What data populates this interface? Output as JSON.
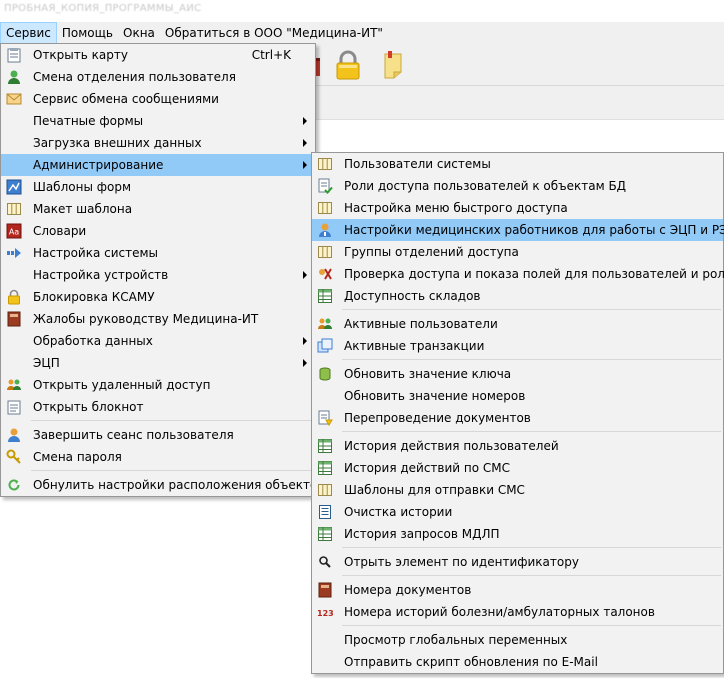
{
  "window": {
    "title": "ПРОБНАЯ_КОПИЯ_ПРОГРАММЫ_АИС"
  },
  "menubar": {
    "items": [
      {
        "label": "Сервис"
      },
      {
        "label": "Помощь"
      },
      {
        "label": "Окна"
      },
      {
        "label": "Обратиться в ООО \"Медицина-ИТ\""
      }
    ]
  },
  "toolbar": {
    "icons": [
      "lock-icon",
      "note-icon"
    ]
  },
  "service_menu": {
    "items": [
      {
        "label": "Открыть карту",
        "shortcut": "Ctrl+K",
        "icon": "card-icon"
      },
      {
        "label": "Смена отделения пользователя",
        "icon": "user-icon"
      },
      {
        "label": "Сервис обмена сообщениями",
        "icon": "envelope-icon"
      },
      {
        "label": "Печатные формы",
        "submenu": true
      },
      {
        "label": "Загрузка внешних данных",
        "submenu": true
      },
      {
        "label": "Администрирование",
        "submenu": true,
        "highlighted": true
      },
      {
        "label": "Шаблоны форм",
        "icon": "template-icon"
      },
      {
        "label": "Макет шаблона",
        "icon": "grid-icon"
      },
      {
        "label": "Словари",
        "icon": "dictionary-icon"
      },
      {
        "label": "Настройка системы",
        "icon": "arrow-icon"
      },
      {
        "label": "Настройка устройств",
        "submenu": true
      },
      {
        "label": "Блокировка КСАМУ",
        "icon": "lock-icon"
      },
      {
        "label": "Жалобы руководству Медицина-ИТ",
        "icon": "book-icon"
      },
      {
        "label": "Обработка данных",
        "submenu": true
      },
      {
        "label": "ЭЦП",
        "submenu": true
      },
      {
        "label": "Открыть удаленный доступ",
        "icon": "users-icon"
      },
      {
        "label": "Открыть блокнот",
        "icon": "notepad-icon"
      },
      {
        "label": "Завершить сеанс пользователя",
        "icon": "logout-icon"
      },
      {
        "label": "Смена пароля",
        "icon": "key-icon"
      },
      {
        "label": "Обнулить настройки расположения объектов",
        "icon": "refresh-icon"
      }
    ]
  },
  "admin_menu": {
    "items": [
      {
        "label": "Пользователи системы",
        "icon": "grid-icon"
      },
      {
        "label": "Роли доступа пользователей к объектам БД",
        "icon": "roles-icon"
      },
      {
        "label": "Настройка меню быстрого доступа",
        "icon": "grid-icon"
      },
      {
        "label": "Настройки медицинских работников для работы с ЭЦП и РЭМД",
        "icon": "doctor-icon",
        "highlighted": true
      },
      {
        "label": "Группы отделений доступа",
        "icon": "grid-icon"
      },
      {
        "label": "Проверка доступа и показа полей для пользователей и ролей",
        "icon": "check-icon"
      },
      {
        "label": "Доступность складов",
        "icon": "table-icon"
      },
      {
        "label": "Активные пользователи",
        "icon": "users-icon"
      },
      {
        "label": "Активные транзакции",
        "icon": "windows-icon"
      },
      {
        "label": "Обновить значение ключа",
        "icon": "database-icon"
      },
      {
        "label": "Обновить значение номеров",
        "icon": ""
      },
      {
        "label": "Перепроведение документов",
        "icon": "documents-icon"
      },
      {
        "label": "История действия пользователей",
        "icon": "table-icon"
      },
      {
        "label": "История действий по СМС",
        "icon": "table-icon"
      },
      {
        "label": "Шаблоны для отправки СМС",
        "icon": "grid-icon"
      },
      {
        "label": "Очистка истории",
        "icon": "list-icon"
      },
      {
        "label": "История запросов МДЛП",
        "icon": "table-icon"
      },
      {
        "label": "Отрыть элемент по идентификатору",
        "icon": "search-icon"
      },
      {
        "label": "Номера документов",
        "icon": "book-icon"
      },
      {
        "label": "Номера историй болезни/амбулаторных талонов",
        "icon": "numbers-icon",
        "icon_text": "123"
      },
      {
        "label": "Просмотр глобальных переменных",
        "icon": ""
      },
      {
        "label": "Отправить скрипт обновления по E-Mail",
        "icon": ""
      }
    ]
  },
  "colors": {
    "menu_bg": "#f2f2f2",
    "highlight": "#91c9f7",
    "menubar_active": "#cce8ff"
  }
}
